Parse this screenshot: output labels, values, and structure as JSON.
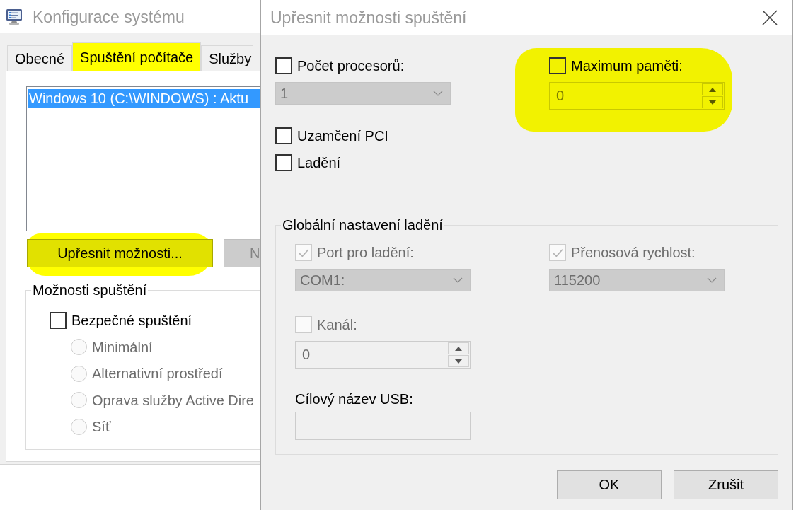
{
  "main_window": {
    "title": "Konfigurace systému",
    "tabs": [
      {
        "label": "Obecné",
        "selected": false,
        "highlighted": false
      },
      {
        "label": "Spuštění počítače",
        "selected": true,
        "highlighted": true
      },
      {
        "label": "Služby",
        "selected": false,
        "highlighted": false
      }
    ],
    "boot_entries": [
      {
        "label": "Windows 10 (C:\\WINDOWS) : Aktu",
        "selected": true
      }
    ],
    "buttons": [
      {
        "label": "Upřesnit možnosti...",
        "disabled": false,
        "highlighted": true
      },
      {
        "label": "N",
        "disabled": true,
        "highlighted": false
      }
    ],
    "boot_options": {
      "title": "Možnosti spuštění",
      "safe_boot": {
        "label": "Bezpečné spuštění",
        "checked": false,
        "disabled": false
      },
      "modes": [
        {
          "label": "Minimální",
          "selected": false,
          "disabled": true
        },
        {
          "label": "Alternativní prostředí",
          "selected": false,
          "disabled": true
        },
        {
          "label": "Oprava služby Active Dire",
          "selected": false,
          "disabled": true
        },
        {
          "label": "Síť",
          "selected": false,
          "disabled": true
        }
      ]
    }
  },
  "dialog": {
    "title": "Upřesnit možnosti spuštění",
    "processor_count": {
      "label": "Počet procesorů:",
      "checked": false,
      "disabled": false,
      "field": {
        "kind": "combo",
        "value": "1",
        "disabled": true
      }
    },
    "max_memory": {
      "label": "Maximum paměti:",
      "checked": false,
      "disabled": false,
      "highlighted": true,
      "field": {
        "kind": "spin",
        "value": "0",
        "disabled": true
      }
    },
    "options": [
      {
        "label": "Uzamčení PCI",
        "checked": false,
        "disabled": false
      },
      {
        "label": "Ladění",
        "checked": false,
        "disabled": false
      }
    ],
    "debug_settings": {
      "title": "Globální nastavení ladění",
      "debug_port": {
        "label": "Port pro ladění:",
        "checked": true,
        "disabled": true,
        "field": {
          "kind": "combo",
          "value": "COM1:",
          "disabled": true
        }
      },
      "baud_rate": {
        "label": "Přenosová rychlost:",
        "checked": true,
        "disabled": true,
        "field": {
          "kind": "combo",
          "value": "115200",
          "disabled": true
        }
      },
      "channel": {
        "label": "Kanál:",
        "checked": false,
        "disabled": true,
        "field": {
          "kind": "spin",
          "value": "0",
          "disabled": true
        }
      },
      "usb_target": {
        "label": "Cílový název USB:",
        "field": {
          "kind": "text",
          "disabled": true
        }
      }
    },
    "buttons": [
      {
        "label": "OK"
      },
      {
        "label": "Zrušit"
      }
    ]
  }
}
